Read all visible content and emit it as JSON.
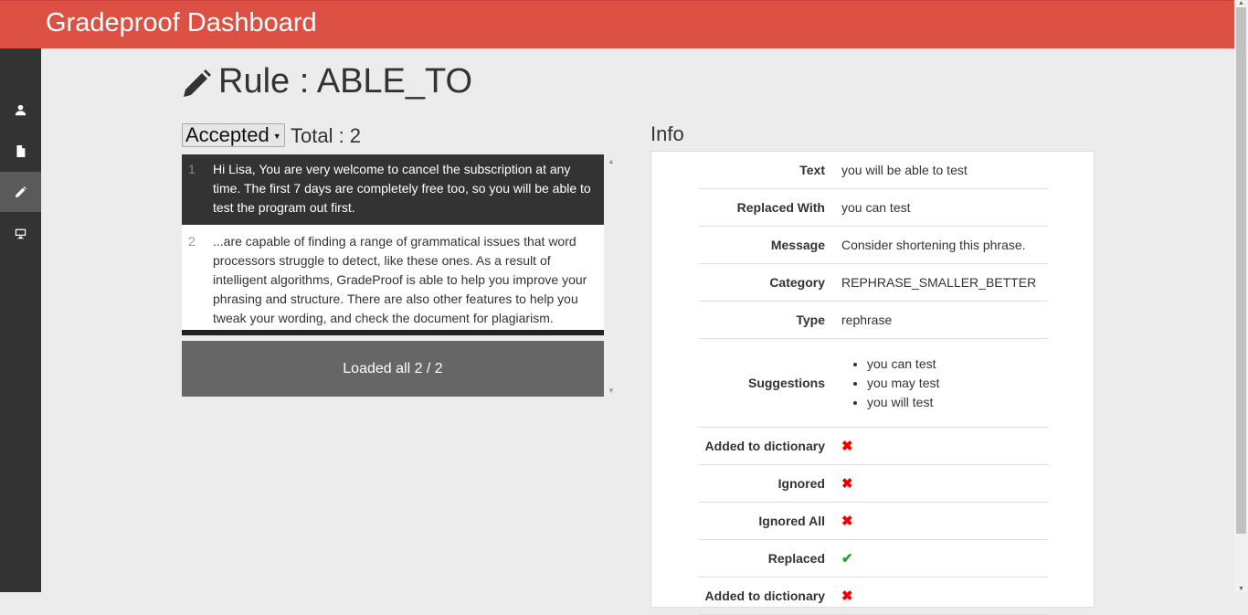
{
  "app": {
    "title": "Gradeproof Dashboard"
  },
  "sidebar": {
    "items": [
      {
        "icon": "user-icon",
        "active": false
      },
      {
        "icon": "document-icon",
        "active": false
      },
      {
        "icon": "pencil-icon",
        "active": true
      },
      {
        "icon": "monitor-icon",
        "active": false
      }
    ]
  },
  "page": {
    "title": "Rule : ABLE_TO"
  },
  "filter": {
    "selected": "Accepted",
    "total_label": "Total : 2"
  },
  "list": {
    "items": [
      {
        "num": "1",
        "text": "Hi Lisa, You are very welcome to cancel the subscription at any time.  The first 7 days are completely free too, so you will be able to test the program out first."
      },
      {
        "num": "2",
        "text": "...are capable of finding a range of grammatical issues that word processors struggle to detect, like these ones. As a result of intelligent algorithms, GradeProof is able to help you improve your phrasing and structure. There are also other features to help you tweak your wording, and check the document for plagiarism."
      }
    ],
    "loaded_text": "Loaded all 2 / 2"
  },
  "info": {
    "heading": "Info",
    "text_label": "Text",
    "text_value": "you will be able to test",
    "replaced_label": "Replaced With",
    "replaced_value": "you can test",
    "message_label": "Message",
    "message_value": "Consider shortening this phrase.",
    "category_label": "Category",
    "category_value": "REPHRASE_SMALLER_BETTER",
    "type_label": "Type",
    "type_value": "rephrase",
    "suggestions_label": "Suggestions",
    "suggestions": [
      "you can test",
      "you may test",
      "you will test"
    ],
    "added_label": "Added to dictionary",
    "added_value": false,
    "ignored_label": "Ignored",
    "ignored_value": false,
    "ignored_all_label": "Ignored All",
    "ignored_all_value": false,
    "replaced_flag_label": "Replaced",
    "replaced_flag_value": true,
    "added2_label": "Added to dictionary",
    "added2_value": false
  },
  "colors": {
    "header": "#dd5044",
    "sidebar": "#333333",
    "success": "#2a9d2a",
    "error": "#e00000"
  }
}
